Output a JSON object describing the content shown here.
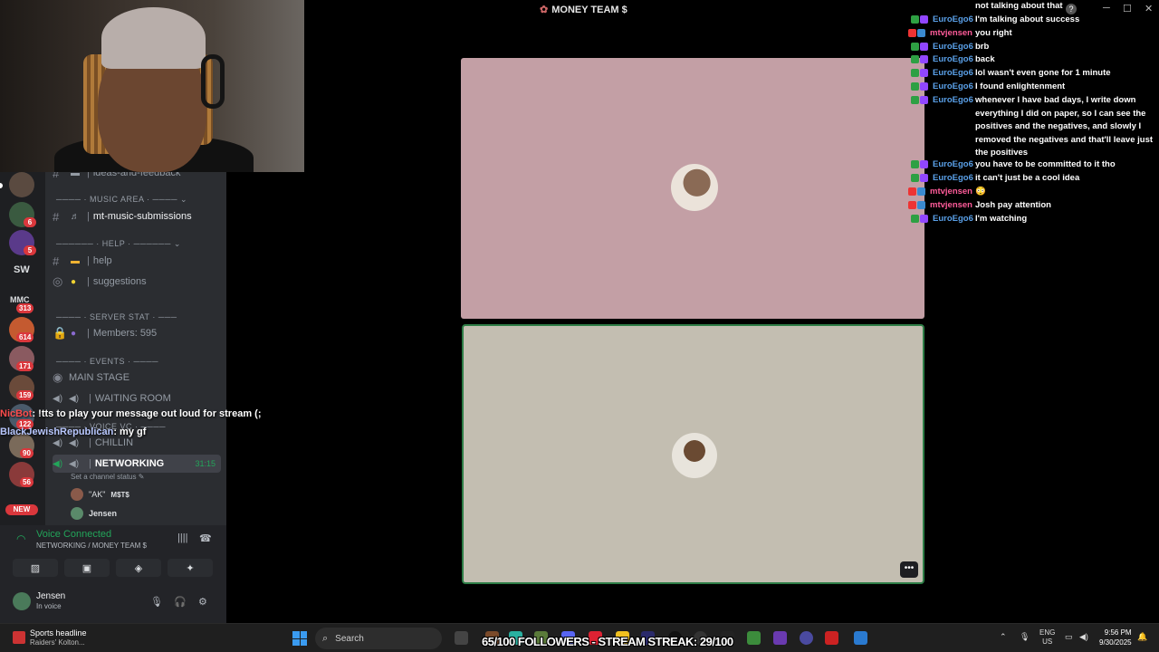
{
  "window": {
    "title": "MONEY TEAM $",
    "title_emoji": "✿"
  },
  "servers": {
    "items": [
      {
        "kind": "avatar",
        "badge": ""
      },
      {
        "kind": "avatar",
        "badge": "6"
      },
      {
        "kind": "avatar",
        "badge": "5"
      },
      {
        "kind": "text",
        "label": "SW",
        "badge": ""
      },
      {
        "kind": "text",
        "label": "MMC",
        "badge": "313"
      },
      {
        "kind": "avatar",
        "badge": "614"
      },
      {
        "kind": "avatar",
        "badge": "171"
      },
      {
        "kind": "avatar",
        "badge": "159"
      },
      {
        "kind": "avatar",
        "badge": "122"
      },
      {
        "kind": "avatar",
        "badge": "90"
      },
      {
        "kind": "avatar",
        "badge": "56"
      },
      {
        "kind": "pill",
        "badge": "NEW"
      }
    ]
  },
  "channels": {
    "top_item": "ideas-and-feedback",
    "music_area_label": "MUSIC AREA",
    "music_submissions": "mt-music-submissions",
    "help_label": "HELP",
    "help": "help",
    "suggestions": "suggestions",
    "server_stat_label": "SERVER STAT",
    "members": "Members: 595",
    "events_label": "EVENTS",
    "main_stage": "MAIN STAGE",
    "waiting_room": "WAITING ROOM",
    "voice_vc_label": "VOICE VC",
    "chillin": "CHILLIN",
    "networking": "NETWORKING",
    "networking_timer": "31:15",
    "channel_status": "Set a channel status",
    "members_in_call": [
      {
        "name": "\"AK\"",
        "tag": "M$T$"
      },
      {
        "name": "Jensen",
        "tag": ""
      }
    ]
  },
  "overlay_chat": [
    {
      "user": "NicBot",
      "text": ": !tts to play your message out loud for stream (;"
    },
    {
      "user": "BlackJewishRepublican",
      "text": ": my gf"
    }
  ],
  "voice": {
    "status": "Voice Connected",
    "location": "NETWORKING / MONEY TEAM $",
    "user_name": "Jensen",
    "user_status": "In voice"
  },
  "chat": {
    "messages": [
      {
        "user": "",
        "text": "not talking about that",
        "platform": "none"
      },
      {
        "user": "EuroEgo6",
        "text": "I'm talking about success",
        "platform": "twitch"
      },
      {
        "user": "mtvjensen",
        "text": "you right",
        "platform": "youtube"
      },
      {
        "user": "EuroEgo6",
        "text": "brb",
        "platform": "twitch"
      },
      {
        "user": "EuroEgo6",
        "text": "back",
        "platform": "twitch"
      },
      {
        "user": "EuroEgo6",
        "text": "lol wasn't even gone for 1 minute",
        "platform": "twitch"
      },
      {
        "user": "EuroEgo6",
        "text": "I found enlightenment",
        "platform": "twitch"
      },
      {
        "user": "EuroEgo6",
        "text": "whenever I have bad days, I write down everything I did on paper, so I can see the positives and the negatives, and slowly I removed the negatives and that'll leave just the positives",
        "platform": "twitch"
      },
      {
        "user": "EuroEgo6",
        "text": "you have to be committed to it tho",
        "platform": "twitch"
      },
      {
        "user": "EuroEgo6",
        "text": "it can't just be a cool idea",
        "platform": "twitch"
      },
      {
        "user": "mtvjensen",
        "text": "😳",
        "platform": "youtube"
      },
      {
        "user": "mtvjensen",
        "text": "Josh pay attention",
        "platform": "youtube"
      },
      {
        "user": "EuroEgo6",
        "text": "I'm watching",
        "platform": "twitch"
      }
    ]
  },
  "taskbar": {
    "news_headline": "Sports headline",
    "news_sub": "Raiders' Kolton...",
    "search_placeholder": "Search",
    "stream_overlay": "65/100 FOLLOWERS - STREAM STREAK: 29/100",
    "lang_top": "ENG",
    "lang_bottom": "US",
    "time": "9:56 PM",
    "date": "9/30/2025"
  },
  "colors": {
    "online_green": "#23a55a",
    "twitch_name": "#5aa0e8",
    "youtube_name": "#ff5c9a"
  }
}
